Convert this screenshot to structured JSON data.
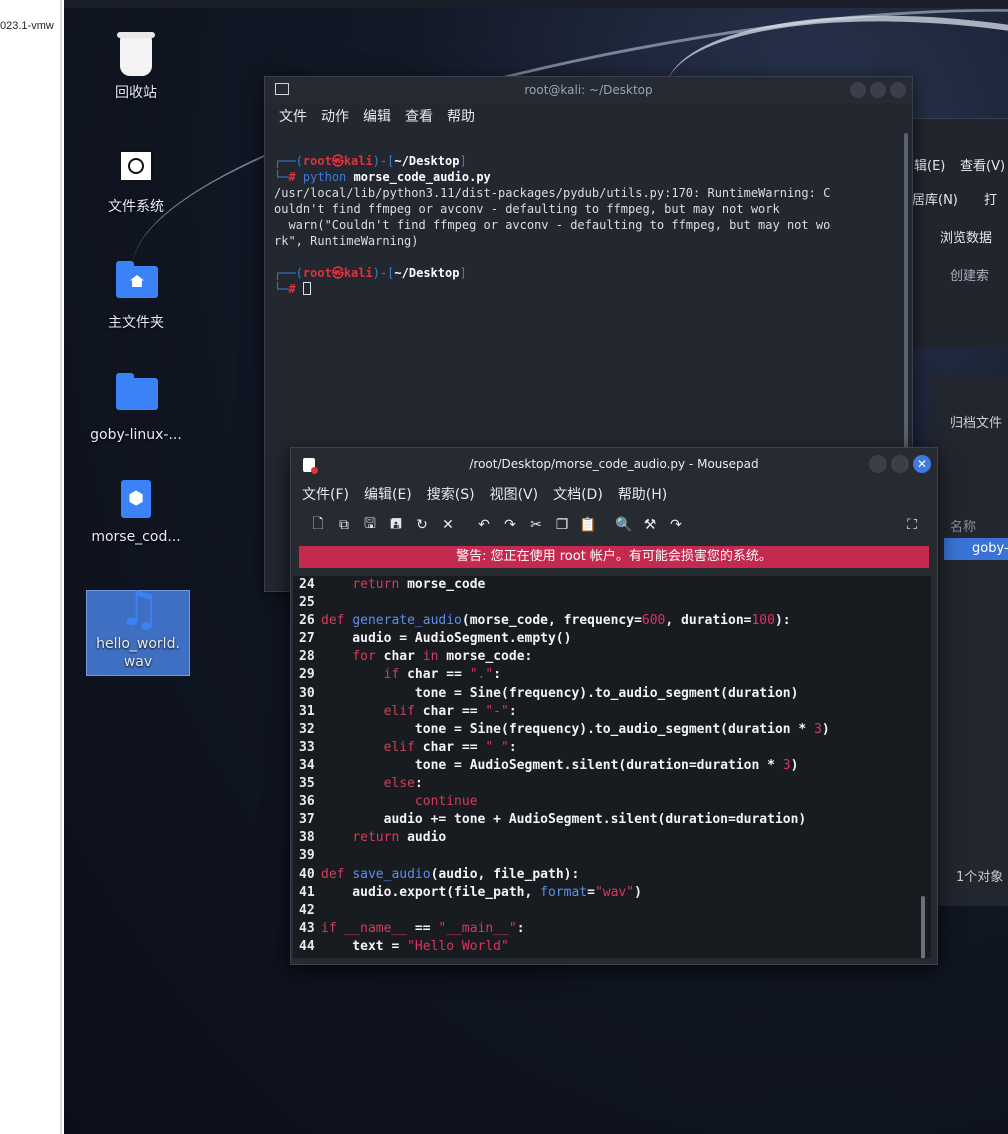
{
  "host": {
    "label": "023.1-vmw"
  },
  "desktop_icons": [
    {
      "label": "回收站"
    },
    {
      "label": "文件系统"
    },
    {
      "label": "主文件夹"
    },
    {
      "label": "goby-linux-..."
    },
    {
      "label": "morse_cod..."
    },
    {
      "label": "hello_world.wav"
    }
  ],
  "terminal": {
    "title": "root@kali: ~/Desktop",
    "menu": [
      "文件",
      "动作",
      "编辑",
      "查看",
      "帮助"
    ],
    "prompt_user": "root",
    "prompt_at": "㉿",
    "prompt_host": "kali",
    "prompt_path": "~/Desktop",
    "command_prefix": "python",
    "command_arg": "morse_code_audio.py",
    "output_lines": [
      "/usr/local/lib/python3.11/dist-packages/pydub/utils.py:170: RuntimeWarning: C",
      "ouldn't find ffmpeg or avconv - defaulting to ffmpeg, but may not work",
      "  warn(\"Couldn't find ffmpeg or avconv - defaulting to ffmpeg, but may not wo",
      "rk\", RuntimeWarning)"
    ]
  },
  "right_window": {
    "menu_edit": "辑(E)",
    "menu_view": "查看(V)",
    "db_label": "居库(N)",
    "btn_open": "打",
    "tab_browse": "浏览数据",
    "create": "创建索"
  },
  "right_window2": {
    "archive": "归档文件",
    "col_name": "名称",
    "item": "goby-",
    "status": "1个对象"
  },
  "mousepad": {
    "title": "/root/Desktop/morse_code_audio.py - Mousepad",
    "menu": [
      "文件(F)",
      "编辑(E)",
      "搜索(S)",
      "视图(V)",
      "文档(D)",
      "帮助(H)"
    ],
    "warning": "警告: 您正在使用 root 帐户。有可能会损害您的系统。",
    "line_numbers": [
      "24",
      "25",
      "26",
      "27",
      "28",
      "29",
      "30",
      "31",
      "32",
      "33",
      "34",
      "35",
      "36",
      "37",
      "38",
      "39",
      "40",
      "41",
      "42",
      "43",
      "44"
    ]
  }
}
